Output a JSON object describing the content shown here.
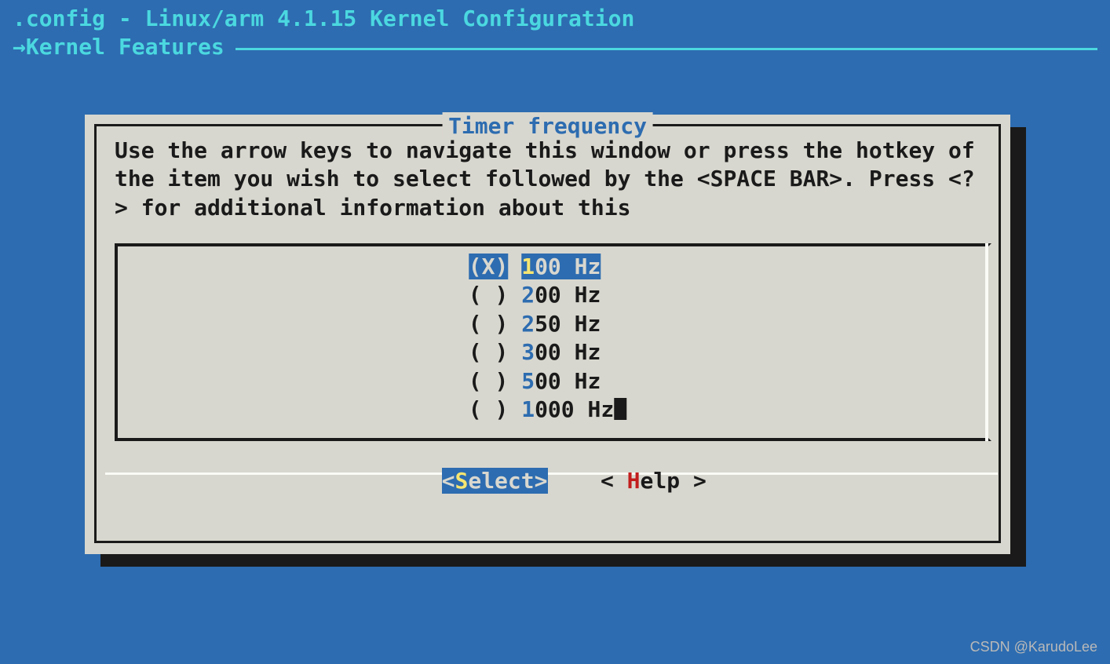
{
  "header": {
    "title": ".config - Linux/arm 4.1.15 Kernel Configuration",
    "arrow": "→ ",
    "breadcrumb": "Kernel Features "
  },
  "dialog": {
    "title": " Timer frequency ",
    "help_text": "Use the arrow keys to navigate this window or press the hotkey of the item you wish to select followed by the <SPACE BAR>. Press <?> for additional information about this",
    "options": [
      {
        "selected": true,
        "marker": "(X)",
        "hotkey": "1",
        "rest": "00 Hz"
      },
      {
        "selected": false,
        "marker": "( )",
        "hotkey": "2",
        "rest": "00 Hz"
      },
      {
        "selected": false,
        "marker": "( )",
        "hotkey": "2",
        "rest": "50 Hz"
      },
      {
        "selected": false,
        "marker": "( )",
        "hotkey": "3",
        "rest": "00 Hz"
      },
      {
        "selected": false,
        "marker": "( )",
        "hotkey": "5",
        "rest": "00 Hz"
      },
      {
        "selected": false,
        "marker": "( )",
        "hotkey": "1",
        "rest": "000 Hz",
        "cursor": true
      }
    ],
    "buttons": {
      "select": {
        "open": "<",
        "hot": "S",
        "rest": "elect>",
        "close": ""
      },
      "help": {
        "open": "< ",
        "hot": "H",
        "rest": "elp >",
        "close": ""
      }
    }
  },
  "watermark": "CSDN @KarudoLee"
}
